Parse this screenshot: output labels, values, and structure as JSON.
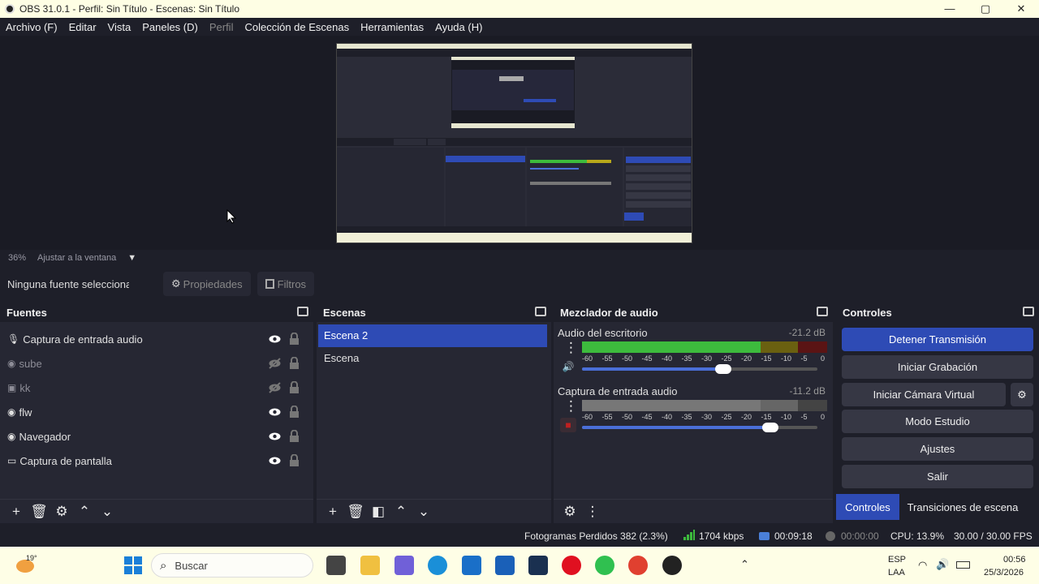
{
  "window": {
    "title": "OBS 31.0.1 - Perfil: Sin Título - Escenas: Sin Título",
    "minimize": "—",
    "maximize": "▢",
    "close": "✕"
  },
  "menu": [
    "Archivo (F)",
    "Editar",
    "Vista",
    "Paneles (D)",
    "Perfil",
    "Colección de Escenas",
    "Herramientas",
    "Ayuda (H)"
  ],
  "zoom": {
    "percent": "36%",
    "mode": "Ajustar a la ventana"
  },
  "toolbar": {
    "no_source": "Ninguna fuente seleccionad",
    "properties": "Propiedades",
    "filters": "Filtros"
  },
  "sources": {
    "title": "Fuentes",
    "items": [
      {
        "label": "Captura de entrada audio",
        "icon": "microphone-icon",
        "visible": true
      },
      {
        "label": "sube",
        "icon": "globe-icon",
        "visible": false
      },
      {
        "label": "kk",
        "icon": "image-icon",
        "visible": false
      },
      {
        "label": "flw",
        "icon": "globe-icon",
        "visible": true
      },
      {
        "label": "Navegador",
        "icon": "globe-icon",
        "visible": true
      },
      {
        "label": "Captura de pantalla",
        "icon": "monitor-icon",
        "visible": true
      }
    ]
  },
  "scenes": {
    "title": "Escenas",
    "items": [
      {
        "label": "Escena 2",
        "selected": true
      },
      {
        "label": "Escena",
        "selected": false
      }
    ]
  },
  "mixer": {
    "title": "Mezclador de audio",
    "scale": [
      "-60",
      "-55",
      "-50",
      "-45",
      "-40",
      "-35",
      "-30",
      "-25",
      "-20",
      "-15",
      "-10",
      "-5",
      "0"
    ],
    "channels": [
      {
        "name": "Audio del escritorio",
        "db": "-21.2 dB",
        "muted": false,
        "level": 0.73,
        "volume": 0.6
      },
      {
        "name": "Captura de entrada audio",
        "db": "-11.2 dB",
        "muted": true,
        "level": 0.85,
        "volume": 0.8
      }
    ]
  },
  "controls": {
    "title": "Controles",
    "buttons": [
      "Detener Transmisión",
      "Iniciar Grabación",
      "Iniciar Cámara Virtual",
      "Modo Estudio",
      "Ajustes",
      "Salir"
    ],
    "tabs": [
      "Controles",
      "Transiciones de escena"
    ]
  },
  "status": {
    "dropped": "Fotogramas Perdidos 382 (2.3%)",
    "bitrate": "1704 kbps",
    "stream_time": "00:09:18",
    "rec_time": "00:00:00",
    "cpu": "CPU: 13.9%",
    "fps": "30.00 / 30.00 FPS"
  },
  "taskbar": {
    "weather": "19°",
    "search": "Buscar",
    "lang1": "ESP",
    "lang2": "LAA",
    "time": "00:56",
    "date": "25/3/2026"
  },
  "colors": {
    "accent": "#2e4bb5",
    "meter_green": "#3dbb3d",
    "meter_yellow": "#b8a81a",
    "meter_red": "#8a1c1c"
  }
}
